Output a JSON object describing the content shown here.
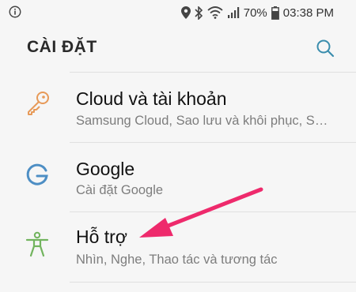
{
  "status_bar": {
    "battery": "70%",
    "time": "03:38 PM",
    "icons": [
      "info-icon",
      "location-icon",
      "bluetooth-icon",
      "wifi-icon",
      "signal-icon",
      "battery-icon"
    ]
  },
  "header": {
    "title": "CÀI ĐẶT",
    "search_icon": "search-icon"
  },
  "settings_items": [
    {
      "icon": "key-icon",
      "title": "Cloud và tài khoản",
      "subtitle": "Samsung Cloud, Sao lưu và khôi phục, Smart Switch"
    },
    {
      "icon": "google-icon",
      "title": "Google",
      "subtitle": "Cài đặt Google"
    },
    {
      "icon": "accessibility-icon",
      "title": "Hỗ trợ",
      "subtitle": "Nhìn, Nghe, Thao tác và tương tác"
    }
  ],
  "colors": {
    "background": "#f6f6f6",
    "accent": "#3a8dad",
    "key_icon": "#e79a59",
    "google_icon": "#4d8ec4",
    "accessibility_icon": "#72b45e",
    "arrow": "#ee2a6c"
  }
}
